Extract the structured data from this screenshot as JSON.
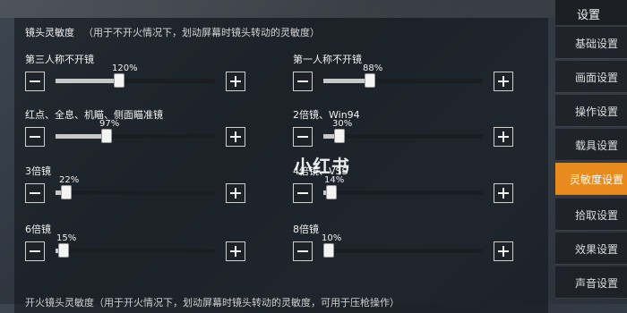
{
  "section": {
    "title": "镜头灵敏度",
    "note": "（用于不开火情况下，划动屏幕时镜头转动的灵敏度）"
  },
  "settings": [
    {
      "label": "第三人称不开镜",
      "value_text": "120%",
      "fraction": 0.4
    },
    {
      "label": "第一人称不开镜",
      "value_text": "88%",
      "fraction": 0.29
    },
    {
      "label": "红点、全息、机瞄、侧面瞄准镜",
      "value_text": "97%",
      "fraction": 0.32
    },
    {
      "label": "2倍镜、Win94",
      "value_text": "30%",
      "fraction": 0.1
    },
    {
      "label": "3倍镜",
      "value_text": "22%",
      "fraction": 0.07
    },
    {
      "label": "4倍镜、VSS",
      "value_text": "14%",
      "fraction": 0.05
    },
    {
      "label": "6倍镜",
      "value_text": "15%",
      "fraction": 0.05
    },
    {
      "label": "8倍镜",
      "value_text": "10%",
      "fraction": 0.03
    }
  ],
  "footer": {
    "text": "开火镜头灵敏度（用于开火情况下，划动屏幕时镜头转动的灵敏度，可用于压枪操作）"
  },
  "sidebar": {
    "header": "设置",
    "items": [
      "基础设置",
      "画面设置",
      "操作设置",
      "载具设置",
      "灵敏度设置",
      "拾取设置",
      "效果设置",
      "声音设置"
    ],
    "active": "灵敏度设置"
  },
  "watermark": "小红书",
  "colors": {
    "accent": "#e98a1f"
  }
}
